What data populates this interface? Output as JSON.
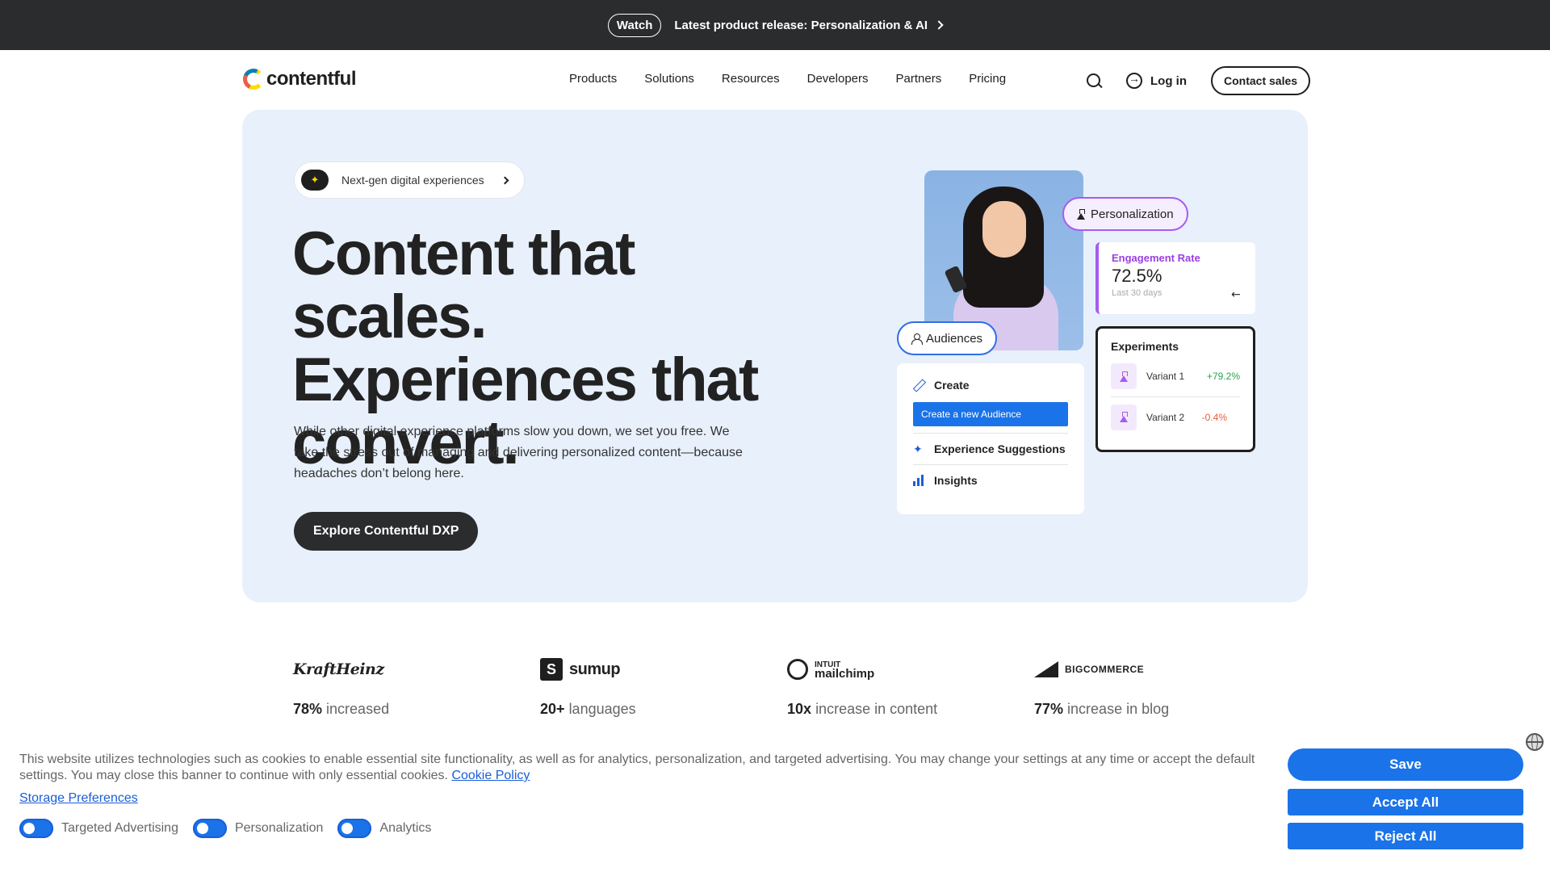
{
  "topbar": {
    "watch_label": "Watch",
    "release_text": "Latest product release: Personalization & AI"
  },
  "nav": {
    "logo_text": "contentful",
    "links": [
      "Products",
      "Solutions",
      "Resources",
      "Developers",
      "Partners",
      "Pricing"
    ],
    "login_label": "Log in",
    "contact_label": "Contact sales"
  },
  "hero": {
    "pill_text": "Next-gen digital experiences",
    "headline": "Content that scales. Experiences that convert.",
    "subcopy": "While other digital experience platforms slow you down, we set you free. We take the stress out of managing and delivering personalized content—because headaches don’t belong here.",
    "cta_label": "Explore Contentful DXP"
  },
  "illustration": {
    "personalization_chip": "Personalization",
    "audiences_chip": "Audiences",
    "engagement": {
      "label": "Engagement Rate",
      "value": "72.5%",
      "sub": "Last 30 days"
    },
    "experiments": {
      "title": "Experiments",
      "variants": [
        {
          "name": "Variant 1",
          "change": "+79.2%"
        },
        {
          "name": "Variant 2",
          "change": "-0.4%"
        }
      ]
    },
    "menu": {
      "create": "Create",
      "create_new": "Create a new Audience",
      "suggestions": "Experience Suggestions",
      "insights": "Insights"
    }
  },
  "stats": [
    {
      "brand": "KraftHeinz",
      "number": "78%",
      "text": "increased"
    },
    {
      "brand": "sumup",
      "number": "20+",
      "text": "languages"
    },
    {
      "brand_line1": "INTUIT",
      "brand_line2": "mailchimp",
      "number": "10x",
      "text": "increase in content"
    },
    {
      "brand_big": "BIG",
      "brand_rest": "COMMERCE",
      "number": "77%",
      "text": "increase in blog"
    }
  ],
  "cookie": {
    "text": "This website utilizes technologies such as cookies to enable essential site functionality, as well as for analytics, personalization, and targeted advertising. You may change your settings at any time or accept the default settings. You may close this banner to continue with only essential cookies.",
    "policy_link": "Cookie Policy",
    "storage_link": "Storage Preferences",
    "toggles": [
      "Targeted Advertising",
      "Personalization",
      "Analytics"
    ],
    "save_label": "Save",
    "accept_label": "Accept All",
    "reject_label": "Reject All"
  },
  "colors": {
    "accent_blue": "#1a73e8",
    "hero_bg": "#e8f0fb",
    "purple": "#a65cf0",
    "topbar_bg": "#2b2c2e"
  }
}
